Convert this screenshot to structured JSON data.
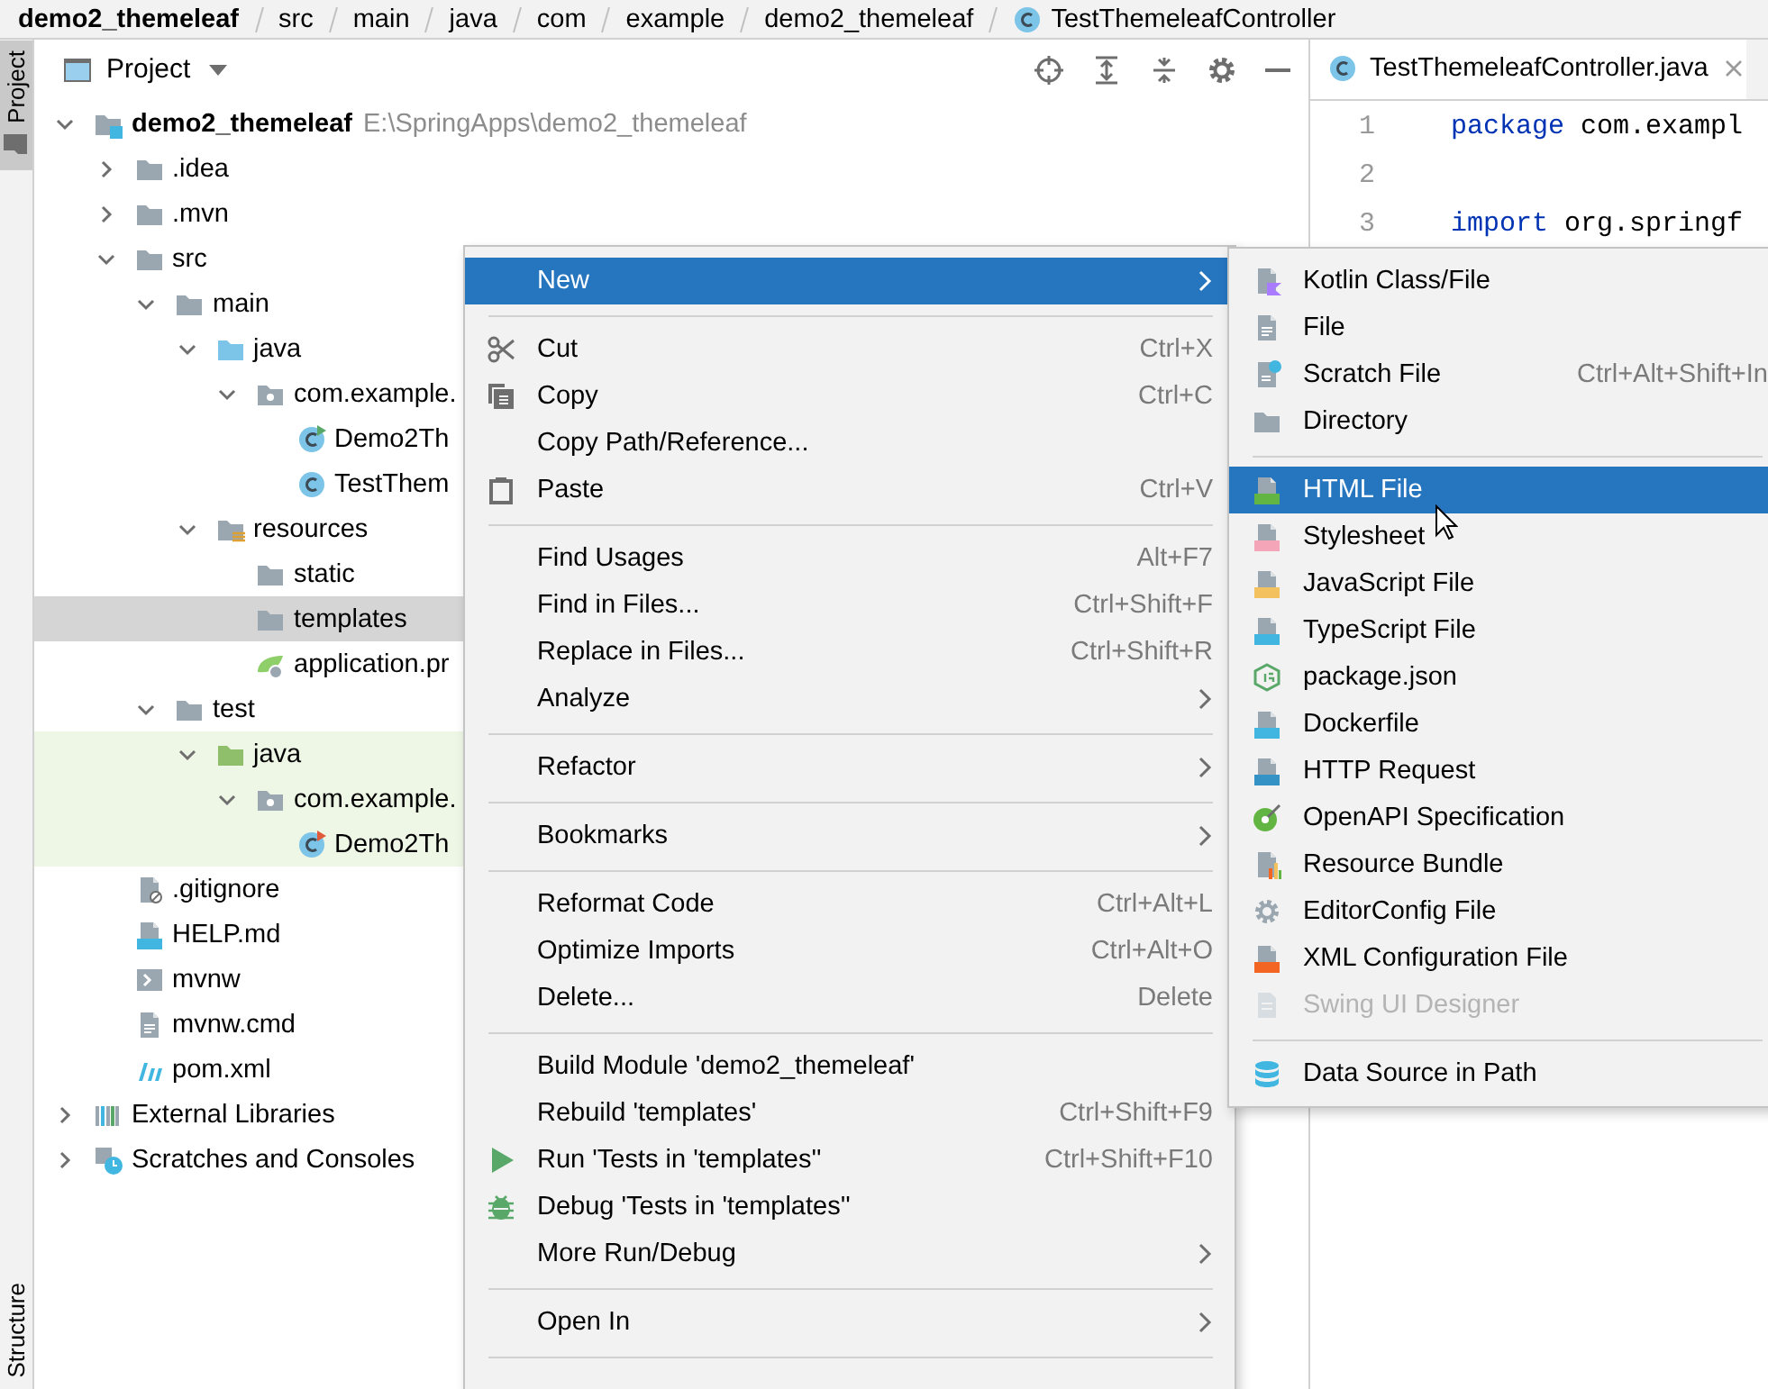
{
  "breadcrumbs": [
    {
      "label": "demo2_themeleaf",
      "kind": "module"
    },
    {
      "label": "src",
      "kind": "folder"
    },
    {
      "label": "main",
      "kind": "folder"
    },
    {
      "label": "java",
      "kind": "folder"
    },
    {
      "label": "com",
      "kind": "folder"
    },
    {
      "label": "example",
      "kind": "folder"
    },
    {
      "label": "demo2_themeleaf",
      "kind": "folder"
    },
    {
      "label": "TestThemeleafController",
      "kind": "class"
    }
  ],
  "tool_tabs_top": [
    {
      "label": "Project",
      "selected": true
    }
  ],
  "tool_tabs_bottom": [
    {
      "label": "Structure",
      "selected": false
    }
  ],
  "project_panel": {
    "title": "Project",
    "tree": [
      {
        "label": "demo2_themeleaf",
        "path": "E:\\SpringApps\\demo2_themeleaf",
        "kind": "module",
        "expanded": true,
        "selected": false,
        "children": [
          {
            "label": ".idea",
            "kind": "folder",
            "expanded": false,
            "selected": false
          },
          {
            "label": ".mvn",
            "kind": "folder",
            "expanded": false,
            "selected": false
          },
          {
            "label": "src",
            "kind": "folder",
            "expanded": true,
            "selected": false,
            "children": [
              {
                "label": "main",
                "kind": "folder",
                "expanded": true,
                "selected": false,
                "children": [
                  {
                    "label": "java",
                    "kind": "source-folder",
                    "expanded": true,
                    "selected": false,
                    "children": [
                      {
                        "label": "com.example.",
                        "kind": "package",
                        "expanded": true,
                        "selected": false,
                        "children": [
                          {
                            "label": "Demo2Th",
                            "kind": "app-class",
                            "selected": false
                          },
                          {
                            "label": "TestThem",
                            "kind": "class",
                            "selected": false
                          }
                        ]
                      }
                    ]
                  },
                  {
                    "label": "resources",
                    "kind": "resources-folder",
                    "expanded": true,
                    "selected": false,
                    "children": [
                      {
                        "label": "static",
                        "kind": "folder",
                        "selected": false
                      },
                      {
                        "label": "templates",
                        "kind": "folder",
                        "selected": true
                      },
                      {
                        "label": "application.pr",
                        "kind": "config-file",
                        "selected": false
                      }
                    ]
                  }
                ]
              },
              {
                "label": "test",
                "kind": "folder",
                "expanded": true,
                "selected": false,
                "children": [
                  {
                    "label": "java",
                    "kind": "test-folder",
                    "expanded": true,
                    "selected": false,
                    "test_scope": true,
                    "children": [
                      {
                        "label": "com.example.",
                        "kind": "package",
                        "expanded": true,
                        "selected": false,
                        "children": [
                          {
                            "label": "Demo2Th",
                            "kind": "test-class",
                            "selected": false
                          }
                        ]
                      }
                    ]
                  }
                ]
              }
            ]
          },
          {
            "label": ".gitignore",
            "kind": "ignore-file",
            "selected": false
          },
          {
            "label": "HELP.md",
            "kind": "markdown",
            "selected": false
          },
          {
            "label": "mvnw",
            "kind": "script",
            "selected": false
          },
          {
            "label": "mvnw.cmd",
            "kind": "text-file",
            "selected": false
          },
          {
            "label": "pom.xml",
            "kind": "maven",
            "selected": false
          }
        ]
      },
      {
        "label": "External Libraries",
        "kind": "libraries",
        "expanded": false,
        "selected": false
      },
      {
        "label": "Scratches and Consoles",
        "kind": "scratches",
        "expanded": false,
        "selected": false
      }
    ]
  },
  "editor": {
    "tab": "TestThemeleafController.java",
    "lines": [
      {
        "number": "1",
        "keyword": "package",
        "text": " com.exampl"
      },
      {
        "number": "2"
      },
      {
        "number": "3",
        "keyword": "import",
        "text": " org.springf"
      }
    ]
  },
  "context_menu": [
    {
      "kind": "item",
      "label": "New",
      "submenu": true,
      "selected": true
    },
    {
      "kind": "separator"
    },
    {
      "kind": "item",
      "label": "Cut",
      "shortcut": "Ctrl+X",
      "selected": false
    },
    {
      "kind": "item",
      "label": "Copy",
      "shortcut": "Ctrl+C",
      "selected": false
    },
    {
      "kind": "item",
      "label": "Copy Path/Reference...",
      "selected": false
    },
    {
      "kind": "item",
      "label": "Paste",
      "shortcut": "Ctrl+V",
      "selected": false
    },
    {
      "kind": "separator"
    },
    {
      "kind": "item",
      "label": "Find Usages",
      "shortcut": "Alt+F7",
      "selected": false
    },
    {
      "kind": "item",
      "label": "Find in Files...",
      "shortcut": "Ctrl+Shift+F",
      "selected": false
    },
    {
      "kind": "item",
      "label": "Replace in Files...",
      "shortcut": "Ctrl+Shift+R",
      "selected": false
    },
    {
      "kind": "item",
      "label": "Analyze",
      "submenu": true,
      "selected": false
    },
    {
      "kind": "separator"
    },
    {
      "kind": "item",
      "label": "Refactor",
      "submenu": true,
      "selected": false
    },
    {
      "kind": "separator"
    },
    {
      "kind": "item",
      "label": "Bookmarks",
      "submenu": true,
      "selected": false
    },
    {
      "kind": "separator"
    },
    {
      "kind": "item",
      "label": "Reformat Code",
      "shortcut": "Ctrl+Alt+L",
      "selected": false
    },
    {
      "kind": "item",
      "label": "Optimize Imports",
      "shortcut": "Ctrl+Alt+O",
      "selected": false
    },
    {
      "kind": "item",
      "label": "Delete...",
      "shortcut": "Delete",
      "selected": false
    },
    {
      "kind": "separator"
    },
    {
      "kind": "item",
      "label": "Build Module 'demo2_themeleaf'",
      "selected": false
    },
    {
      "kind": "item",
      "label": "Rebuild 'templates'",
      "shortcut": "Ctrl+Shift+F9",
      "selected": false
    },
    {
      "kind": "item",
      "label": "Run 'Tests in 'templates''",
      "shortcut": "Ctrl+Shift+F10",
      "selected": false
    },
    {
      "kind": "item",
      "label": "Debug 'Tests in 'templates''",
      "selected": false
    },
    {
      "kind": "item",
      "label": "More Run/Debug",
      "submenu": true,
      "selected": false
    },
    {
      "kind": "separator"
    },
    {
      "kind": "item",
      "label": "Open In",
      "submenu": true,
      "selected": false
    },
    {
      "kind": "separator"
    }
  ],
  "new_submenu": [
    {
      "kind": "item",
      "label": "Kotlin Class/File",
      "selected": false,
      "disabled": false
    },
    {
      "kind": "item",
      "label": "File",
      "selected": false,
      "disabled": false
    },
    {
      "kind": "item",
      "label": "Scratch File",
      "shortcut": "Ctrl+Alt+Shift+In",
      "selected": false,
      "disabled": false
    },
    {
      "kind": "item",
      "label": "Directory",
      "selected": false,
      "disabled": false
    },
    {
      "kind": "separator"
    },
    {
      "kind": "item",
      "label": "HTML File",
      "selected": true,
      "disabled": false
    },
    {
      "kind": "item",
      "label": "Stylesheet",
      "selected": false,
      "disabled": false
    },
    {
      "kind": "item",
      "label": "JavaScript File",
      "selected": false,
      "disabled": false
    },
    {
      "kind": "item",
      "label": "TypeScript File",
      "selected": false,
      "disabled": false
    },
    {
      "kind": "item",
      "label": "package.json",
      "selected": false,
      "disabled": false
    },
    {
      "kind": "item",
      "label": "Dockerfile",
      "selected": false,
      "disabled": false
    },
    {
      "kind": "item",
      "label": "HTTP Request",
      "selected": false,
      "disabled": false
    },
    {
      "kind": "item",
      "label": "OpenAPI Specification",
      "selected": false,
      "disabled": false
    },
    {
      "kind": "item",
      "label": "Resource Bundle",
      "selected": false,
      "disabled": false
    },
    {
      "kind": "item",
      "label": "EditorConfig File",
      "selected": false,
      "disabled": false
    },
    {
      "kind": "item",
      "label": "XML Configuration File",
      "selected": false,
      "disabled": false
    },
    {
      "kind": "item",
      "label": "Swing UI Designer",
      "selected": false,
      "disabled": true
    },
    {
      "kind": "separator"
    },
    {
      "kind": "item",
      "label": "Data Source in Path",
      "selected": false,
      "disabled": false
    }
  ]
}
